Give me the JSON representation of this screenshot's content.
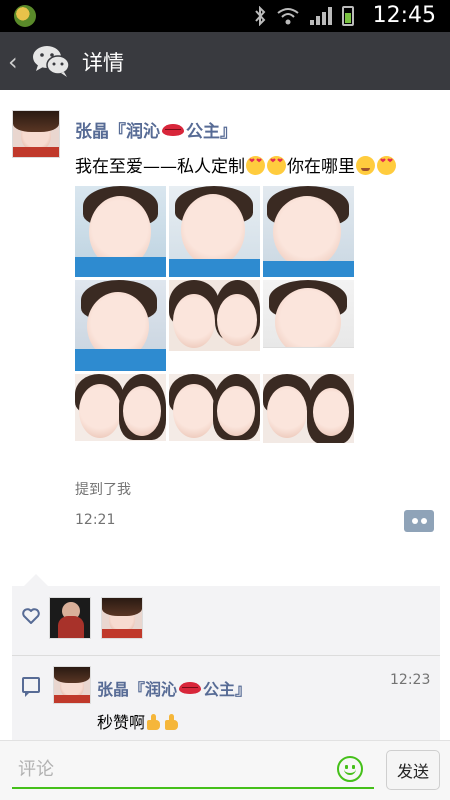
{
  "status_bar": {
    "time": "12:45"
  },
  "header": {
    "title": "详情",
    "back_icon": "chevron-left-icon",
    "logo_icon": "wechat-logo-icon"
  },
  "post": {
    "author": "张晶『润沁",
    "author_suffix": "公主』",
    "text_prefix": "我在至爱——私人定制",
    "text_middle": "你在哪里",
    "mention": "提到了我",
    "time": "12:21",
    "photo_count": 9
  },
  "likes": {
    "icon": "heart-outline-icon",
    "count": 2
  },
  "comments": [
    {
      "author": "张晶『润沁",
      "author_suffix": "公主』",
      "time": "12:23",
      "text": "秒赞啊"
    }
  ],
  "input": {
    "placeholder": "评论",
    "send_label": "发送"
  },
  "colors": {
    "title_bar": "#393a3f",
    "link_blue": "#576b95",
    "accent_green": "#45c01a"
  }
}
